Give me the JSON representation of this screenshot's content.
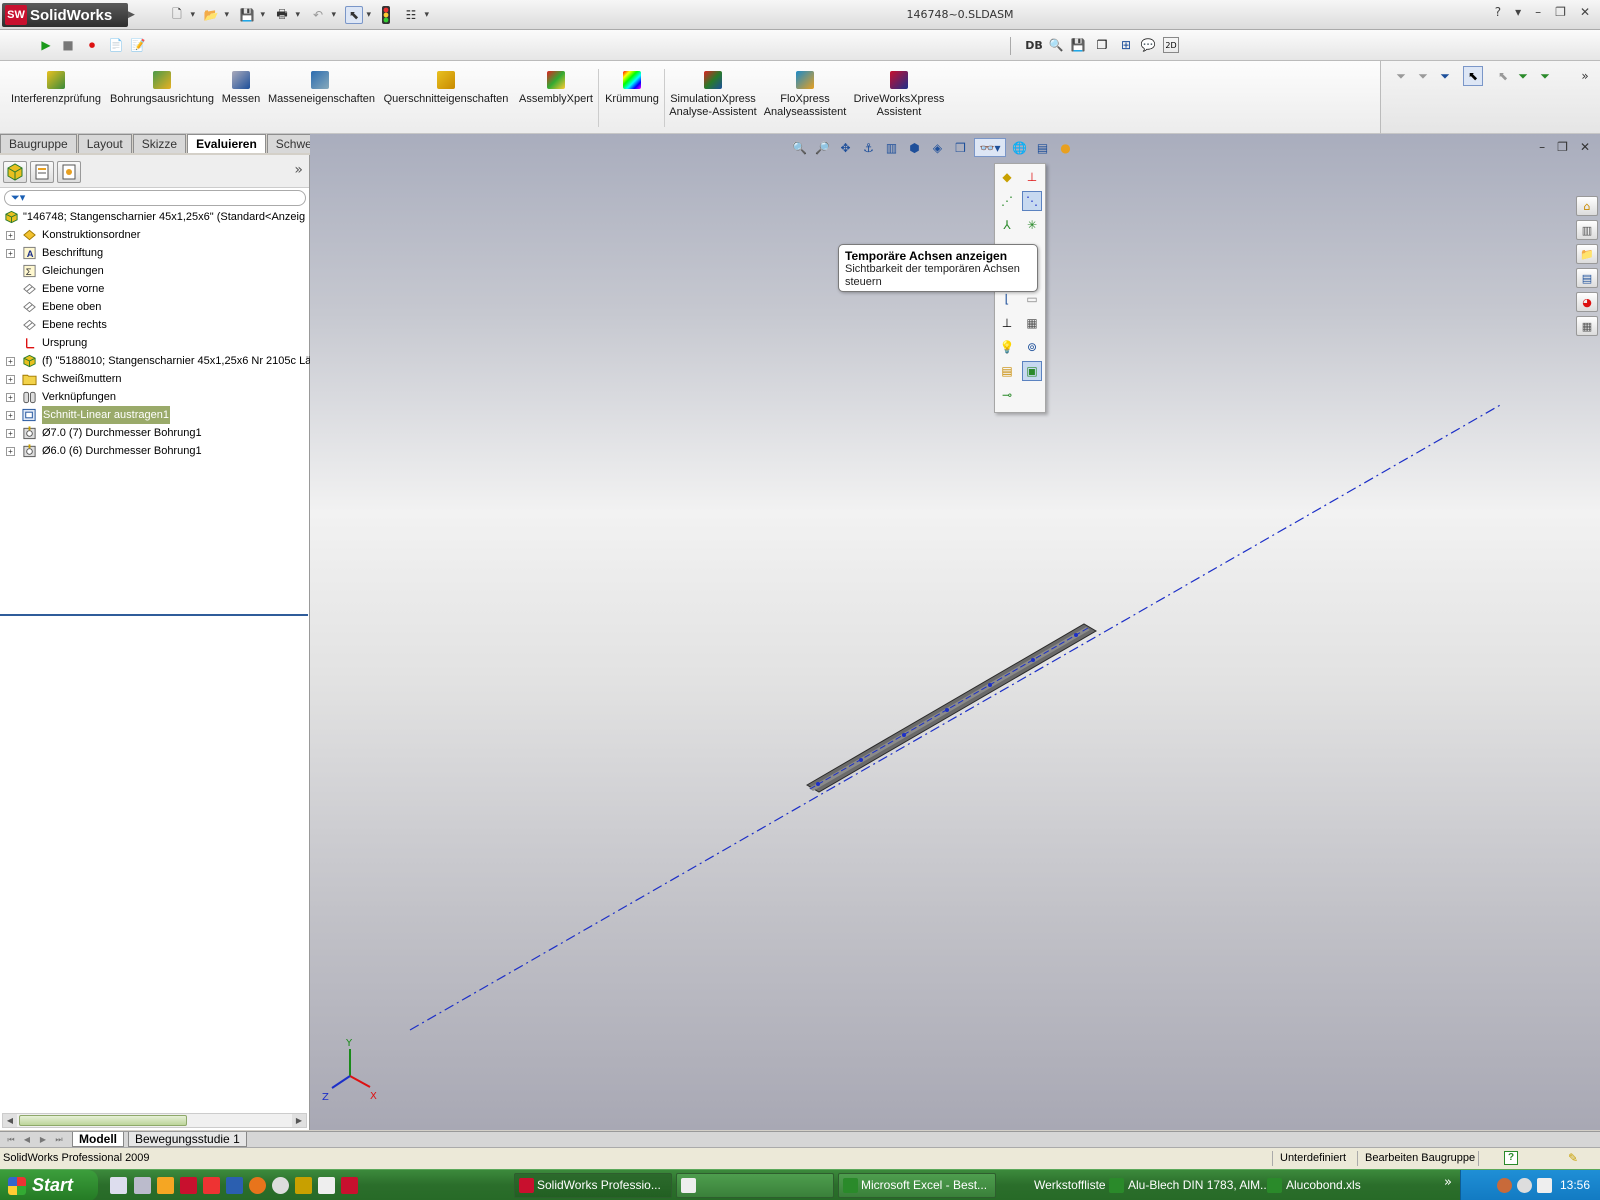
{
  "app": {
    "logo_text": "SolidWorks",
    "document_title": "146748~0.SLDASM",
    "help_label": "?"
  },
  "command_manager": {
    "items": [
      {
        "label": "Interferenzprüfung",
        "icon": "interference-icon"
      },
      {
        "label": "Bohrungsausrichtung",
        "icon": "hole-alignment-icon"
      },
      {
        "label": "Messen",
        "icon": "measure-icon"
      },
      {
        "label": "Masseneigenschaften",
        "icon": "mass-properties-icon"
      },
      {
        "label": "Querschnitteigenschaften",
        "icon": "section-properties-icon"
      },
      {
        "label": "AssemblyXpert",
        "icon": "assemblyxpert-icon"
      },
      {
        "label": "Krümmung",
        "icon": "curvature-icon"
      },
      {
        "label": "SimulationXpress",
        "label2": "Analyse-Assistent",
        "icon": "simulationxpress-icon"
      },
      {
        "label": "FloXpress",
        "label2": "Analyseassistent",
        "icon": "floxpress-icon"
      },
      {
        "label": "DriveWorksXpress",
        "label2": "Assistent",
        "icon": "driveworksxpress-icon"
      }
    ]
  },
  "tabs": [
    "Baugruppe",
    "Layout",
    "Skizze",
    "Evaluieren",
    "Schweißkonstruktionen"
  ],
  "active_tab": "Evaluieren",
  "toolbar2": {
    "db_label": "DB"
  },
  "feature_tree": {
    "root": "\"146748; Stangenscharnier 45x1,25x6\"  (Standard<Anzeig",
    "items": [
      {
        "label": "Konstruktionsordner",
        "icon": "folder-sensor-icon",
        "expandable": true
      },
      {
        "label": "Beschriftung",
        "icon": "annotation-icon",
        "expandable": true
      },
      {
        "label": "Gleichungen",
        "icon": "equations-icon",
        "expandable": false
      },
      {
        "label": "Ebene vorne",
        "icon": "plane-icon",
        "expandable": false
      },
      {
        "label": "Ebene oben",
        "icon": "plane-icon",
        "expandable": false
      },
      {
        "label": "Ebene rechts",
        "icon": "plane-icon",
        "expandable": false
      },
      {
        "label": "Ursprung",
        "icon": "origin-icon",
        "expandable": false
      },
      {
        "label": "(f) \"5188010; Stangenscharnier 45x1,25x6 Nr 2105c Lä",
        "icon": "part-icon",
        "expandable": true
      },
      {
        "label": "Schweißmuttern",
        "icon": "folder-icon",
        "expandable": true
      },
      {
        "label": "Verknüpfungen",
        "icon": "mates-icon",
        "expandable": true
      },
      {
        "label": "Schnitt-Linear austragen1",
        "icon": "cut-extrude-icon",
        "expandable": true,
        "selected": true
      },
      {
        "label": "Ø7.0 (7) Durchmesser Bohrung1",
        "icon": "hole-icon",
        "expandable": true
      },
      {
        "label": "Ø6.0 (6) Durchmesser Bohrung1",
        "icon": "hole-icon",
        "expandable": true
      }
    ]
  },
  "tooltip": {
    "title": "Temporäre Achsen anzeigen",
    "desc_line1": "Sichtbarkeit der temporären Achsen",
    "desc_line2": "steuern"
  },
  "triad": {
    "x": "X",
    "y": "Y",
    "z": "Z"
  },
  "bottom_tabs": [
    "Modell",
    "Bewegungsstudie 1"
  ],
  "status_bar": {
    "app_name": "SolidWorks Professional 2009",
    "state": "Unterdefiniert",
    "mode": "Bearbeiten Baugruppe"
  },
  "taskbar": {
    "start_label": "Start",
    "tasks": [
      {
        "label": "SolidWorks Professio...",
        "active": true
      },
      {
        "label": "",
        "active": false
      },
      {
        "label": "Microsoft Excel - Best...",
        "active": false
      }
    ],
    "plain_items": [
      "Werkstoffliste",
      "Alu-Blech DIN 1783, AlM...",
      "Alucobond.xls"
    ],
    "overflow": "»",
    "clock": "13:56"
  },
  "colors": {
    "selection": "#9aaa6a",
    "axis_line": "#1c2fc8",
    "taskbar": "#2b6e2b"
  }
}
